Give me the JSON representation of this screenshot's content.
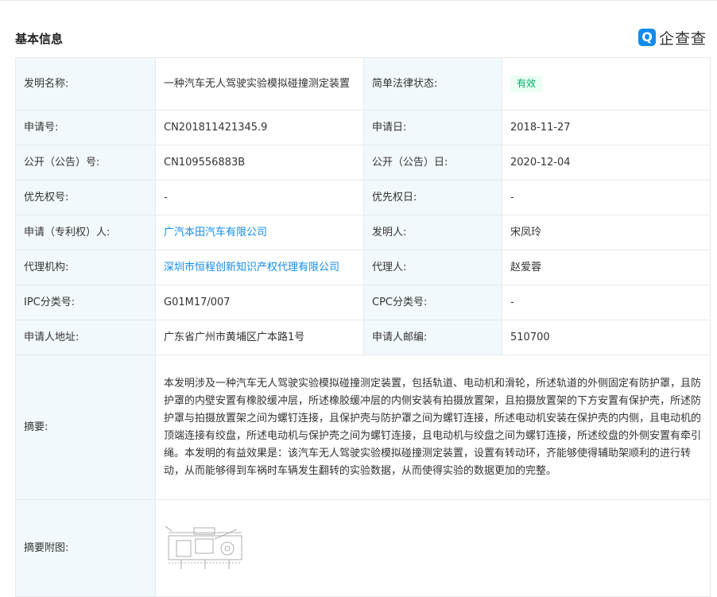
{
  "header": {
    "section_title": "基本信息",
    "brand_icon_char": "Q",
    "brand_name": "企查查",
    "brand_color": "#128bed"
  },
  "fields": {
    "invention_name_label": "发明名称:",
    "invention_name": "一种汽车无人驾驶实验模拟碰撞测定装置",
    "legal_status_label": "简单法律状态:",
    "legal_status": "有效",
    "application_no_label": "申请号:",
    "application_no": "CN201811421345.9",
    "application_date_label": "申请日:",
    "application_date": "2018-11-27",
    "publication_no_label": "公开（公告）号:",
    "publication_no": "CN109556883B",
    "publication_date_label": "公开（公告）日:",
    "publication_date": "2020-12-04",
    "priority_no_label": "优先权号:",
    "priority_no": "-",
    "priority_date_label": "优先权日:",
    "priority_date": "-",
    "applicant_label": "申请（专利权）人:",
    "applicant": "广汽本田汽车有限公司",
    "inventor_label": "发明人:",
    "inventor": "宋凤玲",
    "agency_label": "代理机构:",
    "agency": "深圳市恒程创新知识产权代理有限公司",
    "agent_label": "代理人:",
    "agent": "赵爱蓉",
    "ipc_label": "IPC分类号:",
    "ipc": "G01M17/007",
    "cpc_label": "CPC分类号:",
    "cpc": "-",
    "address_label": "申请人地址:",
    "address": "广东省广州市黄埔区广本路1号",
    "postcode_label": "申请人邮编:",
    "postcode": "510700",
    "abstract_label": "摘要:",
    "abstract": "本发明涉及一种汽车无人驾驶实验模拟碰撞测定装置，包括轨道、电动机和滑轮，所述轨道的外侧固定有防护罩，且防护罩的内壁安置有橡胶缓冲层，所述橡胶缓冲层的内侧安装有拍摄放置架，且拍摄放置架的下方安置有保护壳，所述防护罩与拍摄放置架之间为螺钉连接，且保护壳与防护罩之间为螺钉连接，所述电动机安装在保护壳的内侧，且电动机的顶端连接有绞盘，所述电动机与保护壳之间为螺钉连接，且电动机与绞盘之间为螺钉连接，所述绞盘的外侧安置有牵引绳。本发明的有益效果是：该汽车无人驾驶实验模拟碰撞测定装置，设置有转动环，齐能够使得辅助架顺利的进行转动，从而能够得到车祸时车辆发生翻转的实验数据，从而使得实验的数据更加的完整。",
    "abstract_figure_label": "摘要附图:"
  }
}
